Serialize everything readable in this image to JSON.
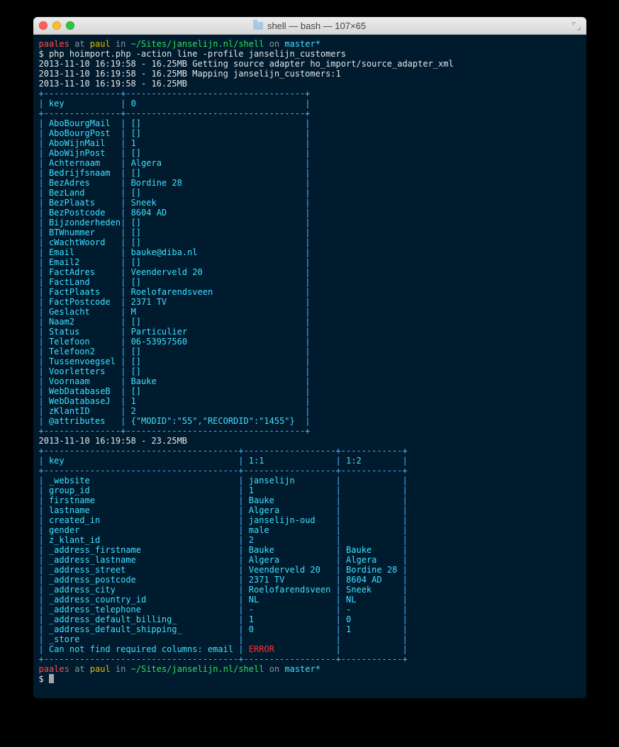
{
  "window": {
    "title": "shell — bash — 107×65"
  },
  "prompt": {
    "user": "paales",
    "at": "at",
    "host": "paul",
    "in": "in",
    "path": "~/Sites/janselijn.nl/shell",
    "on": "on",
    "branch": "master*",
    "symbol": "$"
  },
  "command": "php hoimport.php -action line -profile janselijn_customers",
  "log1": "2013-11-10 16:19:58 - 16.25MB Getting source adapter ho_import/source_adapter_xml",
  "log2": "2013-11-10 16:19:58 - 16.25MB Mapping janselijn_customers:1",
  "log3": "2013-11-10 16:19:58 - 16.25MB",
  "table1": {
    "divider_top": "+---------------+-----------------------------------+",
    "header": "| key           | 0                                 |",
    "divider_mid": "+---------------+-----------------------------------+",
    "rows": [
      [
        "AboBourgMail",
        "[]"
      ],
      [
        "AboBourgPost",
        "[]"
      ],
      [
        "AboWijnMail",
        "1"
      ],
      [
        "AboWijnPost",
        "[]"
      ],
      [
        "Achternaam",
        "Algera"
      ],
      [
        "Bedrijfsnaam",
        "[]"
      ],
      [
        "BezAdres",
        "Bordine 28"
      ],
      [
        "BezLand",
        "[]"
      ],
      [
        "BezPlaats",
        "Sneek"
      ],
      [
        "BezPostcode",
        "8604 AD"
      ],
      [
        "Bijzonderheden",
        "[]"
      ],
      [
        "BTWnummer",
        "[]"
      ],
      [
        "cWachtWoord",
        "[]"
      ],
      [
        "Email",
        "bauke@diba.nl"
      ],
      [
        "Email2",
        "[]"
      ],
      [
        "FactAdres",
        "Veenderveld 20"
      ],
      [
        "FactLand",
        "[]"
      ],
      [
        "FactPlaats",
        "Roelofarendsveen"
      ],
      [
        "FactPostcode",
        "2371 TV"
      ],
      [
        "Geslacht",
        "M"
      ],
      [
        "Naam2",
        "[]"
      ],
      [
        "Status",
        "Particulier"
      ],
      [
        "Telefoon",
        "06-53957560"
      ],
      [
        "Telefoon2",
        "[]"
      ],
      [
        "Tussenvoegsel",
        "[]"
      ],
      [
        "Voorletters",
        "[]"
      ],
      [
        "Voornaam",
        "Bauke"
      ],
      [
        "WebDatabaseB",
        "[]"
      ],
      [
        "WebDatabaseJ",
        "1"
      ],
      [
        "zKlantID",
        "2"
      ],
      [
        "@attributes",
        "{\"MODID\":\"55\",\"RECORDID\":\"1455\"}"
      ]
    ],
    "divider_bot": "+---------------+-----------------------------------+"
  },
  "log4": "2013-11-10 16:19:58 - 23.25MB",
  "table2": {
    "divider_top": "+------------------------------------+------------------+------------+",
    "header_key": "key",
    "header_c1": "1:1",
    "header_c2": "1:2",
    "divider_mid": "+------------------------------------+------------------+------------+",
    "rows": [
      [
        "_website",
        "janselijn",
        ""
      ],
      [
        "group_id",
        "1",
        ""
      ],
      [
        "firstname",
        "Bauke",
        ""
      ],
      [
        "lastname",
        "Algera",
        ""
      ],
      [
        "created_in",
        "janselijn-oud",
        ""
      ],
      [
        "gender",
        "male",
        ""
      ],
      [
        "z_klant_id",
        "2",
        ""
      ],
      [
        "_address_firstname",
        "Bauke",
        "Bauke"
      ],
      [
        "_address_lastname",
        "Algera",
        "Algera"
      ],
      [
        "_address_street",
        "Veenderveld 20",
        "Bordine 28"
      ],
      [
        "_address_postcode",
        "2371 TV",
        "8604 AD"
      ],
      [
        "_address_city",
        "Roelofarendsveen",
        "Sneek"
      ],
      [
        "_address_country_id",
        "NL",
        "NL"
      ],
      [
        "_address_telephone",
        "-",
        "-"
      ],
      [
        "_address_default_billing_",
        "1",
        "0"
      ],
      [
        "_address_default_shipping_",
        "0",
        "1"
      ],
      [
        "_store",
        "",
        ""
      ]
    ],
    "error_row_key": "Can not find required columns: email",
    "error_row_val": "ERROR",
    "divider_bot": "+------------------------------------+------------------+------------+"
  }
}
